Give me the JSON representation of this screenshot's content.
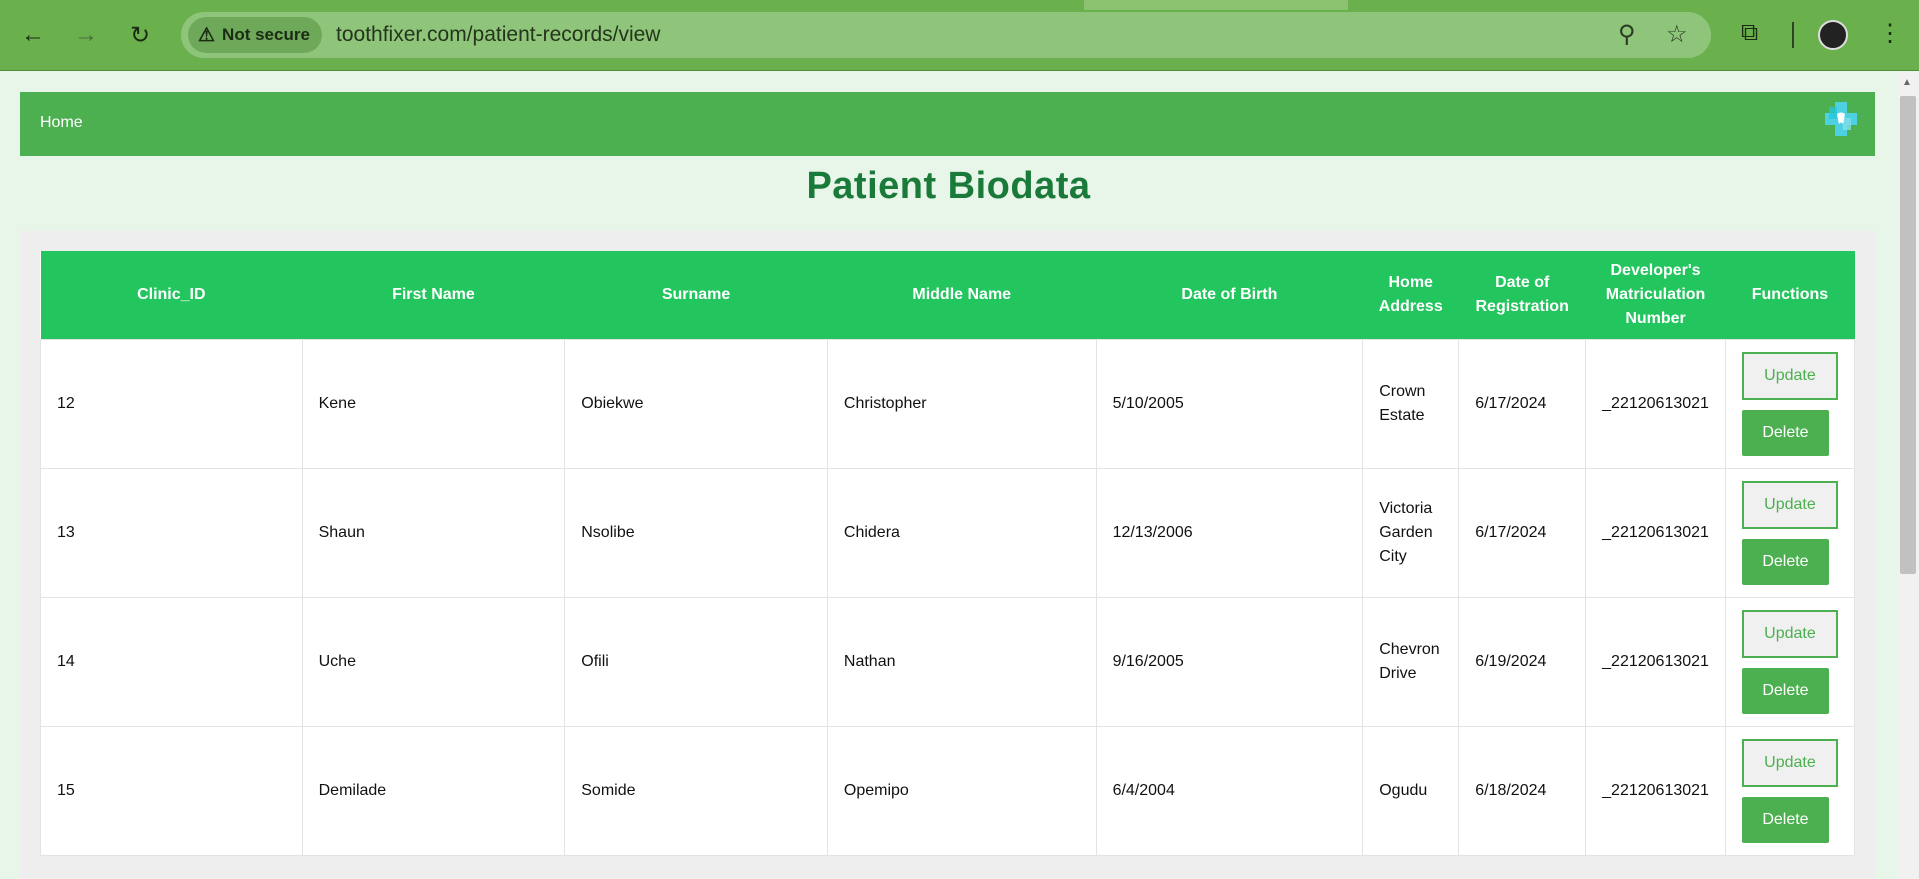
{
  "browser": {
    "security_label": "Not secure",
    "url": "toothfixer.com/patient-records/view",
    "icons": [
      "back-icon",
      "forward-icon",
      "reload-icon",
      "warning-icon",
      "zoom-icon",
      "star-icon",
      "extensions-icon",
      "profile-avatar",
      "menu-icon"
    ]
  },
  "navbar": {
    "home_label": "Home",
    "logo": "dental-cross-logo"
  },
  "page_title": "Patient Biodata",
  "table": {
    "headers": [
      "Clinic_ID",
      "First Name",
      "Surname",
      "Middle Name",
      "Date of Birth",
      "Home Address",
      "Date of Registration",
      "Developer's Matriculation Number",
      "Functions"
    ],
    "rows": [
      {
        "clinic_id": "12",
        "first_name": "Kene",
        "surname": "Obiekwe",
        "middle_name": "Christopher",
        "dob": "5/10/2005",
        "address": "Crown Estate",
        "reg_date": "6/17/2024",
        "matric": "_22120613021",
        "update_label": "Update",
        "delete_label": "Delete"
      },
      {
        "clinic_id": "13",
        "first_name": "Shaun",
        "surname": "Nsolibe",
        "middle_name": "Chidera",
        "dob": "12/13/2006",
        "address": "Victoria Garden City",
        "reg_date": "6/17/2024",
        "matric": "_22120613021",
        "update_label": "Update",
        "delete_label": "Delete"
      },
      {
        "clinic_id": "14",
        "first_name": "Uche",
        "surname": "Ofili",
        "middle_name": "Nathan",
        "dob": "9/16/2005",
        "address": "Chevron Drive",
        "reg_date": "6/19/2024",
        "matric": "_22120613021",
        "update_label": "Update",
        "delete_label": "Delete"
      },
      {
        "clinic_id": "15",
        "first_name": "Demilade",
        "surname": "Somide",
        "middle_name": "Opemipo",
        "dob": "6/4/2004",
        "address": "Ogudu",
        "reg_date": "6/18/2024",
        "matric": "_22120613021",
        "update_label": "Update",
        "delete_label": "Delete"
      }
    ]
  },
  "colors": {
    "chrome": "#6ab04c",
    "navbar": "#4caf50",
    "table_header": "#22c55e",
    "title": "#1a7a3a",
    "page_bg": "#e8f5e9"
  }
}
